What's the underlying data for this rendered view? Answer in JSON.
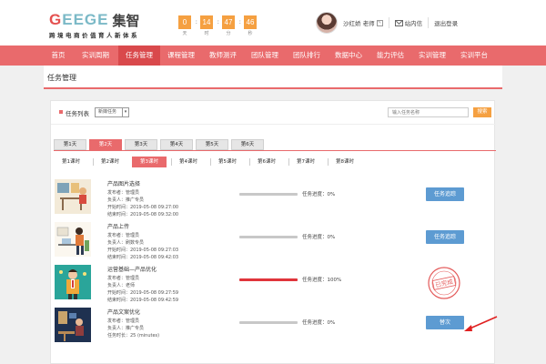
{
  "header": {
    "logo_en": "GEEGE",
    "logo_en_first": "G",
    "logo_en_rest": "EEGE",
    "logo_cn": "集智",
    "logo_sub": "跨境电商价值育人新体系",
    "timer": [
      {
        "value": "0",
        "label": "天"
      },
      {
        "value": "14",
        "label": "时"
      },
      {
        "value": "47",
        "label": "分"
      },
      {
        "value": "46",
        "label": "秒"
      }
    ],
    "user_name": "沙红娇 老师",
    "inbox_label": "站内信",
    "logout_label": "退出登录"
  },
  "nav": {
    "items": [
      {
        "label": "首页"
      },
      {
        "label": "实训周期"
      },
      {
        "label": "任务管理"
      },
      {
        "label": "课程管理"
      },
      {
        "label": "教师测评"
      },
      {
        "label": "团队管理"
      },
      {
        "label": "团队排行"
      },
      {
        "label": "数据中心"
      },
      {
        "label": "能力评估"
      },
      {
        "label": "实训管理"
      },
      {
        "label": "实训平台"
      }
    ],
    "active_index": 2
  },
  "page": {
    "title": "任务管理",
    "list_label": "任务列表",
    "select_value": "新媒任务",
    "search_placeholder": "输入任务名称",
    "search_button": "搜索"
  },
  "day_tabs": [
    "第1天",
    "第2天",
    "第3天",
    "第4天",
    "第5天",
    "第6天"
  ],
  "day_active": 1,
  "lesson_tabs": [
    "第1课时",
    "第2课时",
    "第3课时",
    "第4课时",
    "第5课时",
    "第6课时",
    "第7课时",
    "第8课时"
  ],
  "lesson_active": 2,
  "tasks": [
    {
      "title": "产品图片选择",
      "publisher": "发布者：管理员",
      "owner": "负责人：推广专员",
      "start": "开始时间：2019-05-08 09:27:00",
      "end": "结束时间：2019-05-08 09:32:00",
      "progress_label": "任务进度：0%",
      "progress": 0,
      "button": "任务追踪"
    },
    {
      "title": "产品上传",
      "publisher": "发布者：管理员",
      "owner": "负责人：刷数专员",
      "start": "开始时间：2019-05-08 09:27:03",
      "end": "结束时间：2019-05-08 09:42:03",
      "progress_label": "任务进度：0%",
      "progress": 0,
      "button": "任务追踪"
    },
    {
      "title": "运营基础—产品优化",
      "publisher": "发布者：管理员",
      "owner": "负责人：老师",
      "start": "开始时间：2019-05-08 09:27:59",
      "end": "结束时间：2019-05-08 09:42:59",
      "progress_label": "任务进度：100%",
      "progress": 100,
      "stamp_text": "已完成"
    },
    {
      "title": "产品文案优化",
      "publisher": "发布者：管理员",
      "owner": "负责人：推广专员",
      "duration": "任务时长：25 (minutes)",
      "progress_label": "任务进度：0%",
      "progress": 0,
      "button": "替次"
    }
  ],
  "colors": {
    "nav_bg": "#e96a6c",
    "accent": "#e96a6c",
    "timer": "#f5a041",
    "button": "#5d9bd2",
    "progress_full": "#e0353b"
  }
}
